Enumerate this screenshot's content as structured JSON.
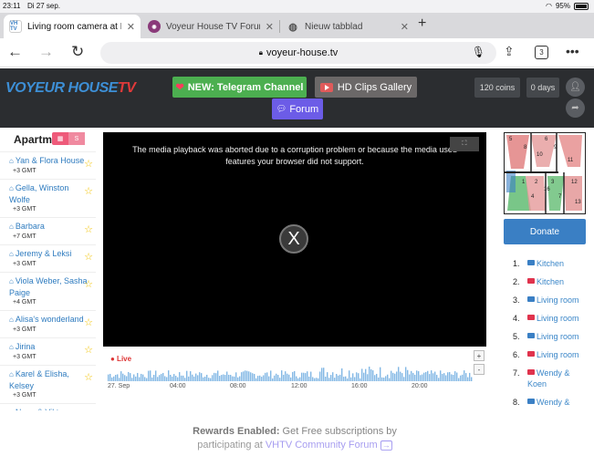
{
  "status_bar": {
    "time": "23:11",
    "date": "Di 27 sep.",
    "battery": "95%"
  },
  "tabs": [
    {
      "title": "Living room camera at M…",
      "favicon": "VH TV",
      "active": true
    },
    {
      "title": "Voyeur House TV Forum…",
      "favicon": "forum-icon",
      "active": false
    },
    {
      "title": "Nieuw tabblad",
      "favicon": "globe-icon",
      "active": false
    }
  ],
  "toolbar": {
    "url": "voyeur-house.tv",
    "tab_count": "3"
  },
  "header": {
    "logo_main": "VOYEUR HOUSE",
    "logo_tv": "TV",
    "telegram_label": "NEW: Telegram Channel",
    "clips_label": "HD Clips Gallery",
    "forum_label": "Forum",
    "coins": "120 coins",
    "days": "0 days"
  },
  "sidebar": {
    "title": "Apartm",
    "toggle_a": "▦",
    "toggle_b": "S",
    "apartments": [
      {
        "name": "Yan & Flora House",
        "gmt": "+3 GMT"
      },
      {
        "name": "Gella, Winston Wolfe",
        "gmt": "+3 GMT"
      },
      {
        "name": "Barbara",
        "gmt": "+7 GMT"
      },
      {
        "name": "Jeremy & Leksi",
        "gmt": "+3 GMT"
      },
      {
        "name": "Viola Weber, Sasha Paige",
        "gmt": "+4 GMT"
      },
      {
        "name": "Alisa's wonderland",
        "gmt": "+3 GMT"
      },
      {
        "name": "Jirina",
        "gmt": "+3 GMT"
      },
      {
        "name": "Karel & Elisha, Kelsey",
        "gmt": "+3 GMT"
      },
      {
        "name": "Nena & Viktor",
        "gmt": ""
      }
    ]
  },
  "video": {
    "message": "The media playback was aborted due to a corruption problem or because the media used features your browser did not support.",
    "close_glyph": "X",
    "fullscreen_glyph": "⛶"
  },
  "timeline": {
    "live_label": "● Live",
    "labels": [
      "27. Sep",
      "04:00",
      "08:00",
      "12:00",
      "16:00",
      "20:00"
    ],
    "zoom_in": "+",
    "zoom_out": "-"
  },
  "right_panel": {
    "donate_label": "Donate",
    "cameras": [
      {
        "num": "1.",
        "label": "Kitchen",
        "color": "#3a7fc4"
      },
      {
        "num": "2.",
        "label": "Kitchen",
        "color": "#e0334d"
      },
      {
        "num": "3.",
        "label": "Living room",
        "color": "#3a7fc4"
      },
      {
        "num": "4.",
        "label": "Living room",
        "color": "#e0334d"
      },
      {
        "num": "5.",
        "label": "Living room",
        "color": "#3a7fc4"
      },
      {
        "num": "6.",
        "label": "Living room",
        "color": "#e0334d"
      },
      {
        "num": "7.",
        "label": "Wendy & Koen",
        "color": "#e0334d"
      },
      {
        "num": "8.",
        "label": "Wendy &",
        "color": "#3a7fc4"
      }
    ],
    "floorplan_rooms": [
      "5",
      "6",
      "8",
      "9",
      "10",
      "11",
      "1",
      "2",
      "3",
      "16",
      "12",
      "4",
      "7",
      "13"
    ]
  },
  "rewards": {
    "bold": "Rewards Enabled:",
    "text1": " Get Free subscriptions by",
    "text2": "participating at ",
    "link": "VHTV Community Forum",
    "arrow": "→"
  },
  "colors": {
    "accent_blue": "#3a7fc4",
    "telegram_green": "#4caf50",
    "forum_purple": "#6c5ce7",
    "header_dark": "#2b2d30"
  }
}
